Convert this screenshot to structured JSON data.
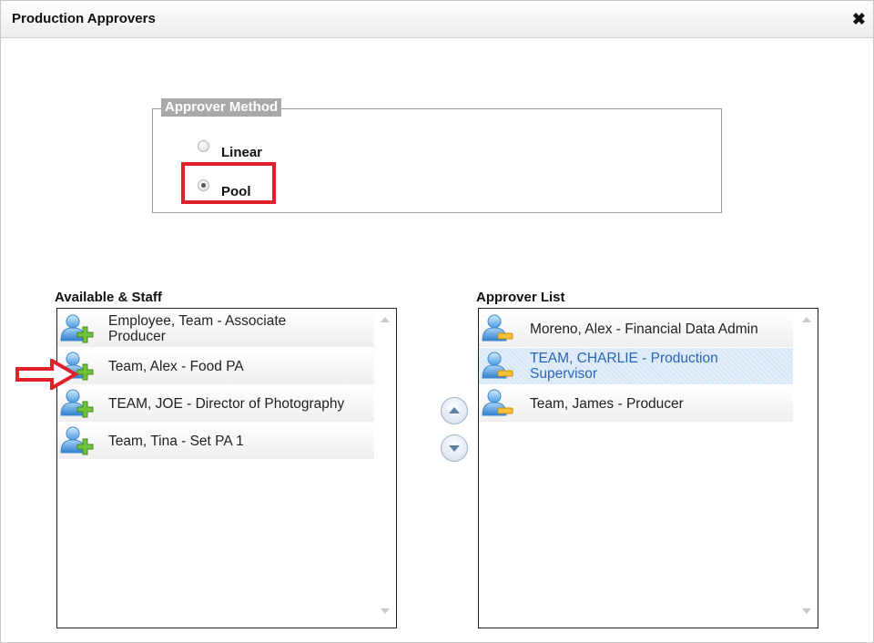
{
  "dialog": {
    "title": "Production Approvers",
    "close_glyph": "✖"
  },
  "approver_method": {
    "legend": "Approver Method",
    "options": [
      {
        "label": "Linear",
        "checked": false
      },
      {
        "label": "Pool",
        "checked": true
      }
    ]
  },
  "available": {
    "title": "Available & Staff",
    "items": [
      {
        "line1": "Employee, Team - Associate",
        "line2": "Producer",
        "icon": "add-user-icon"
      },
      {
        "line1": "Team, Alex - Food PA",
        "line2": "",
        "icon": "add-user-icon"
      },
      {
        "line1": "TEAM, JOE - Director of Photography",
        "line2": "",
        "icon": "add-user-icon"
      },
      {
        "line1": "Team, Tina - Set PA 1",
        "line2": "",
        "icon": "add-user-icon"
      }
    ]
  },
  "approvers": {
    "title": "Approver List",
    "items": [
      {
        "line1": "Moreno, Alex - Financial Data Admin",
        "line2": "",
        "icon": "remove-user-icon",
        "selected": false
      },
      {
        "line1": "TEAM, CHARLIE - Production",
        "line2": "Supervisor",
        "icon": "remove-user-icon",
        "selected": true
      },
      {
        "line1": "Team, James - Producer",
        "line2": "",
        "icon": "remove-user-icon",
        "selected": false
      }
    ]
  },
  "colors": {
    "highlight": "#e0202a",
    "selected_text": "#2a66b8"
  }
}
